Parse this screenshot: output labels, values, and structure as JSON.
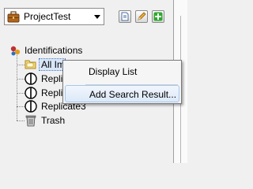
{
  "project_selector": {
    "value": "ProjectTest",
    "icon": "briefcase-icon"
  },
  "toolbar": {
    "buttons": [
      {
        "name": "new-project-button",
        "icon": "document-icon"
      },
      {
        "name": "edit-project-button",
        "icon": "pencil-icon"
      },
      {
        "name": "add-project-button",
        "icon": "plus-icon"
      }
    ]
  },
  "tree": {
    "root": {
      "label": "Identifications",
      "icon": "identifications-icon"
    },
    "items": [
      {
        "label": "All Im",
        "icon": "folder-icon",
        "selected": true
      },
      {
        "label": "Replic",
        "icon": "replicate-icon"
      },
      {
        "label": "Replic",
        "icon": "replicate-icon"
      },
      {
        "label": "Replicate3",
        "icon": "replicate-icon"
      },
      {
        "label": "Trash",
        "icon": "trash-icon"
      }
    ]
  },
  "context_menu": {
    "items": [
      {
        "label": "Display List"
      },
      {
        "label": "Add Search Result...",
        "hovered": true
      }
    ]
  },
  "colors": {
    "selection": "#d8e6f8",
    "menu_hover": "#dce9f8",
    "plus_green": "#2fa82f"
  }
}
